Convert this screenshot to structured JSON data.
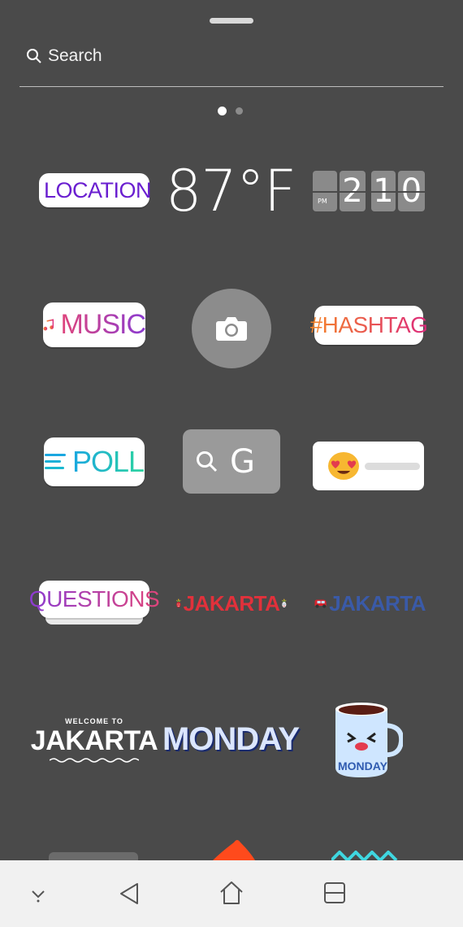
{
  "search": {
    "placeholder": "Search"
  },
  "stickers": {
    "location": "LOCATION",
    "temperature": "87°F",
    "clock": {
      "period": "PM",
      "hour": "2",
      "minute_tens": "1",
      "minute_ones": "0"
    },
    "music": "MUSIC",
    "camera_icon": "camera-icon",
    "hashtag": "#HASHTAG",
    "poll": "POLL",
    "gif_letter": "G",
    "emoji_slider": "heart-eyes-emoji",
    "questions": "QUESTIONS",
    "jakarta_red": "JAKARTA",
    "jakarta_blue": "JAKARTA",
    "welcome_small": "WELCOME TO",
    "welcome_big": "JAKARTA",
    "monday": "MONDAY",
    "monday_mug": "MONDAY"
  },
  "pager": {
    "pages": 2,
    "active": 1
  },
  "colors": {
    "background": "#4a4a4a",
    "navbar": "#f1f1f1"
  },
  "navbar": {
    "icons": [
      "hide-keyboard-icon",
      "back-icon",
      "home-icon",
      "recents-icon"
    ]
  }
}
